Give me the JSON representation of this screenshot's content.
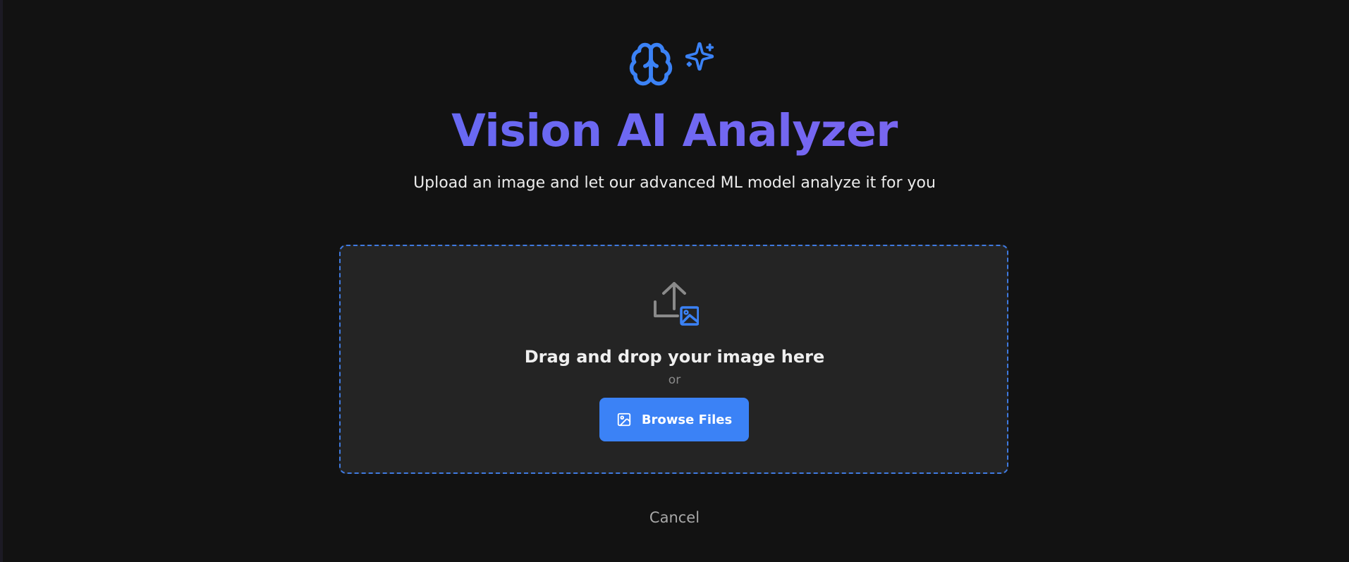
{
  "header": {
    "icons": [
      "brain-icon",
      "sparkles-icon"
    ],
    "title": "Vision AI Analyzer",
    "subtitle": "Upload an image and let our advanced ML model analyze it for you"
  },
  "upload": {
    "icon": "upload-image-icon",
    "drop_text": "Drag and drop your image here",
    "or_text": "or",
    "browse_label": "Browse Files",
    "browse_icon": "image-icon"
  },
  "actions": {
    "cancel_label": "Cancel"
  },
  "colors": {
    "background": "#121212",
    "dropzone_bg": "#242424",
    "accent": "#3b82f6",
    "title_gradient_start": "#5b6bf3",
    "title_gradient_end": "#8a63ef"
  }
}
